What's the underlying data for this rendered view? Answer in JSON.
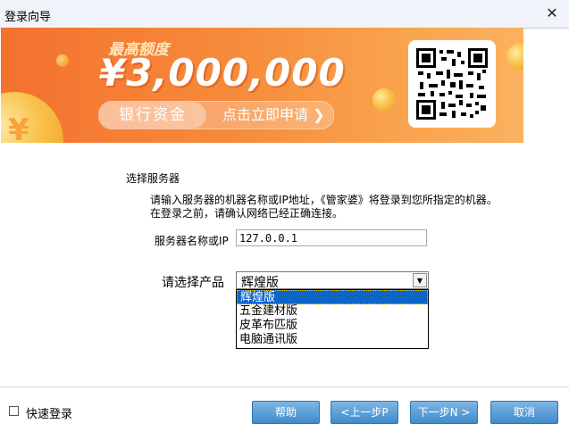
{
  "window": {
    "title": "登录向导"
  },
  "banner": {
    "subtitle": "最高额度",
    "amount": "¥3,000,000",
    "pill_left": "银行资金",
    "pill_right": "点击立即申请 ❯"
  },
  "section": {
    "title": "选择服务器",
    "desc_line1": "请输入服务器的机器名称或IP地址，《管家婆》将登录到您所指定的机器。",
    "desc_line2": "在登录之前，请确认网络已经正确连接。"
  },
  "server": {
    "label": "服务器名称或IP",
    "value": "127.0.0.1"
  },
  "product": {
    "label": "请选择产品",
    "selected": "辉煌版",
    "options": [
      "辉煌版",
      "五金建材版",
      "皮革布匹版",
      "电脑通讯版"
    ]
  },
  "quick_login": {
    "label": "快速登录",
    "checked": false
  },
  "buttons": {
    "help": "帮助",
    "prev": "<上一步P",
    "next": "下一步N >",
    "cancel": "取消"
  },
  "colors": {
    "banner_orange": "#f4712e",
    "button_blue": "#3f8bcb",
    "selection": "#0f64c8"
  },
  "icons": {
    "close": "close-icon",
    "checkbox": "checkbox-icon",
    "dropdown": "chevron-down-icon"
  }
}
